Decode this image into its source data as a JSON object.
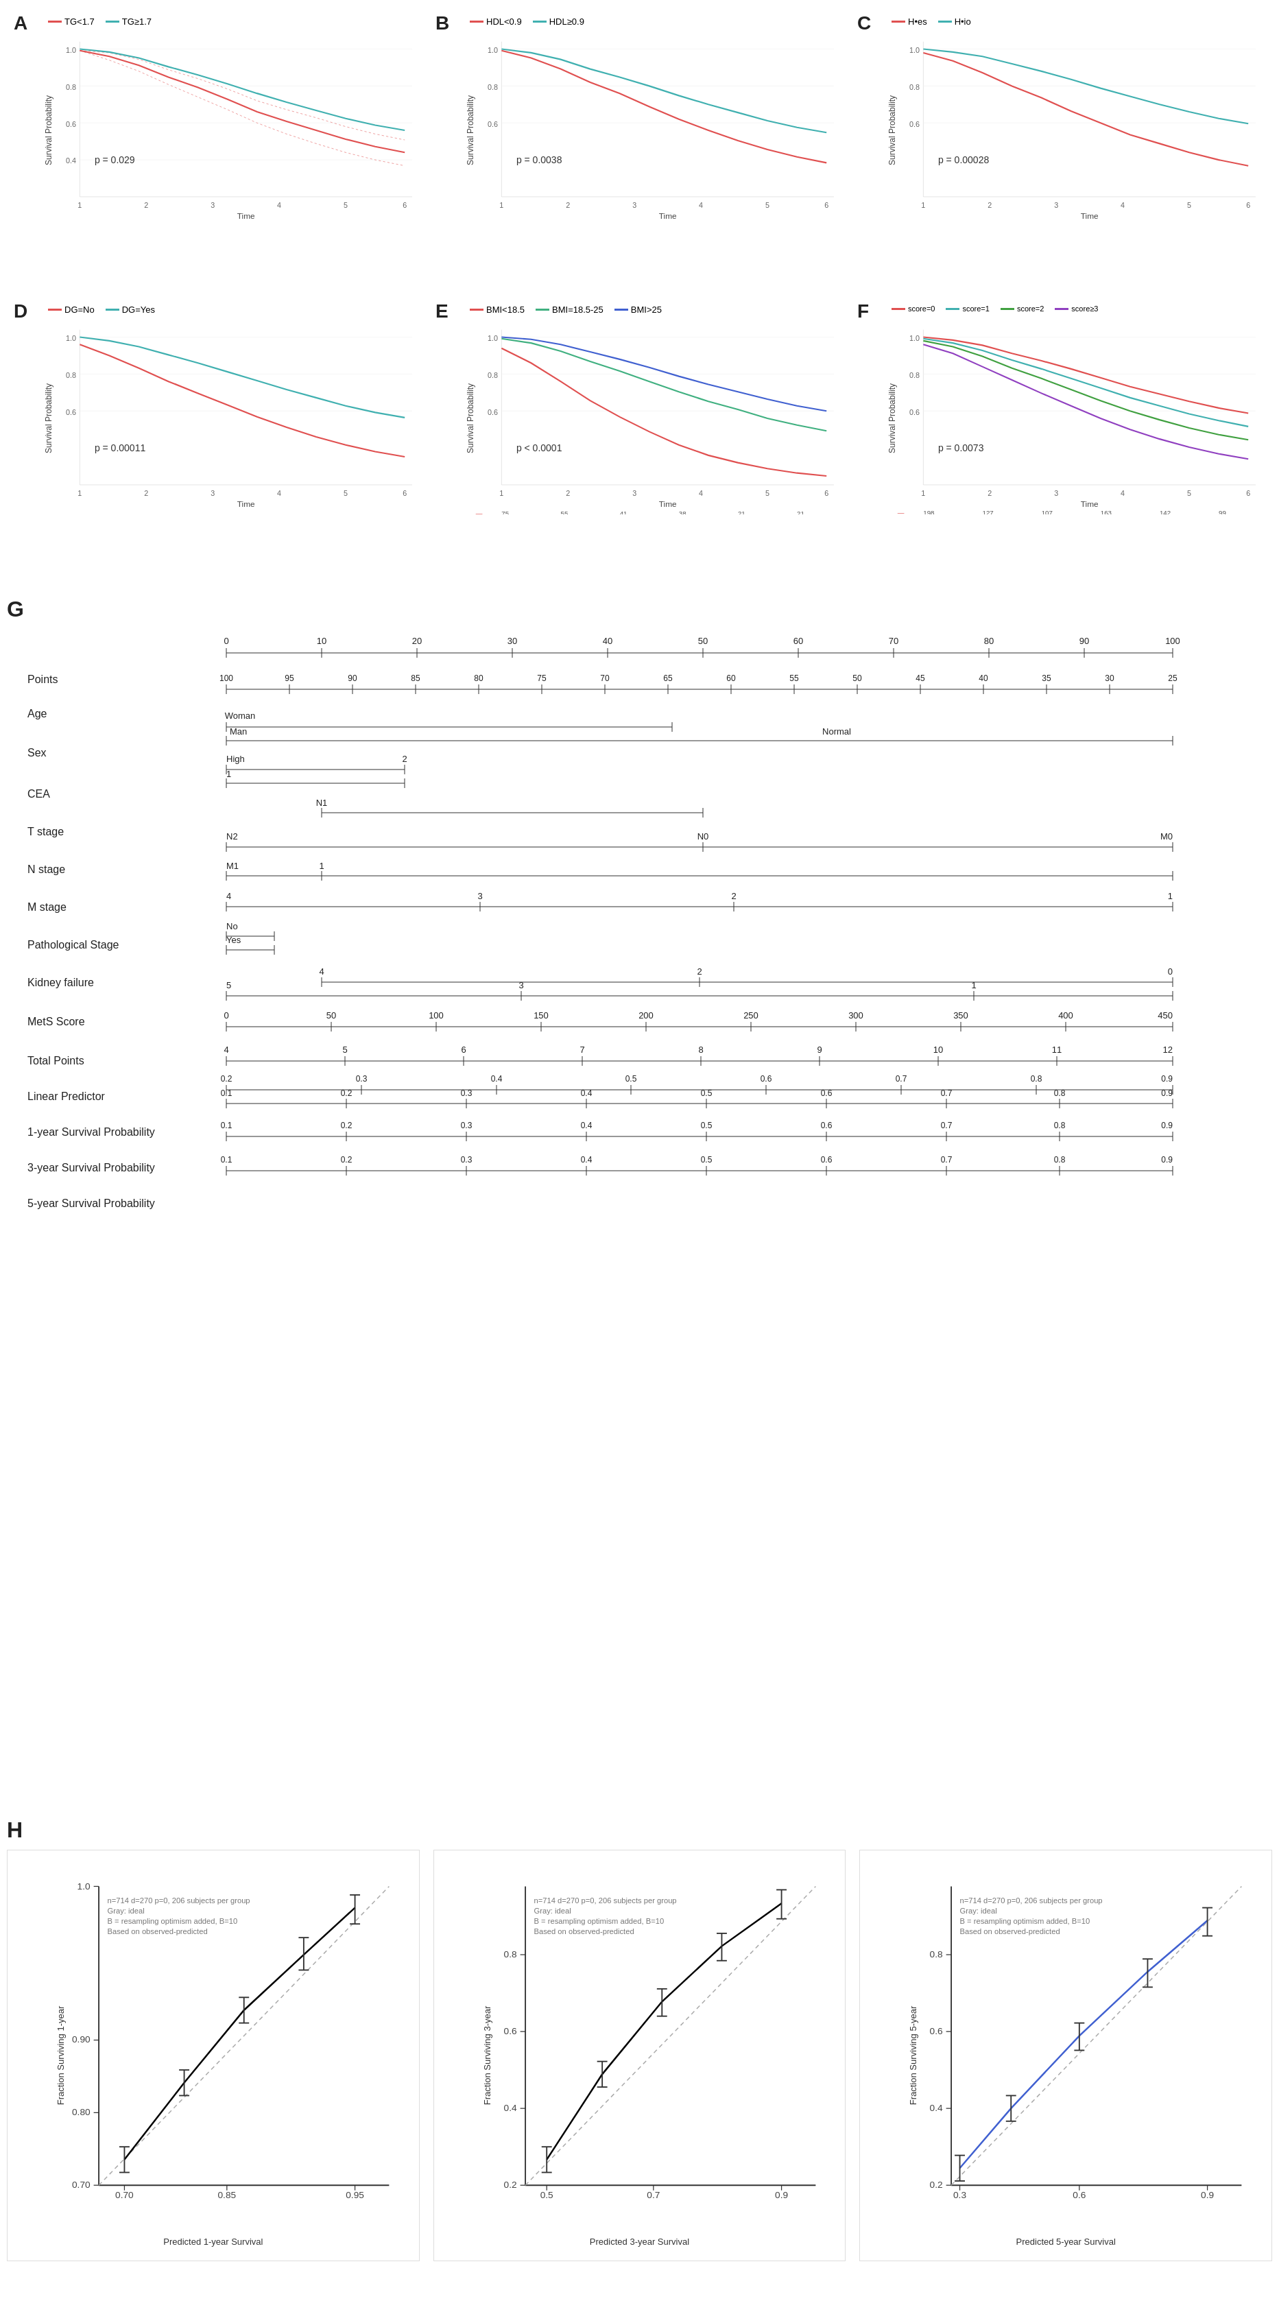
{
  "panels": {
    "A": {
      "label": "A",
      "legend": [
        {
          "text": "TG<1.7",
          "color": "#e05050"
        },
        {
          "text": "TG≥1.7",
          "color": "#40b0b0"
        }
      ],
      "pvalue": "p = 0.029",
      "yaxis": "Survival Probability",
      "xaxis": "Time"
    },
    "B": {
      "label": "B",
      "legend": [
        {
          "text": "HDL<0.9",
          "color": "#e05050"
        },
        {
          "text": "HDL≥0.9",
          "color": "#40b0b0"
        }
      ],
      "pvalue": "p = 0.0038",
      "yaxis": "Survival Probability",
      "xaxis": "Time"
    },
    "C": {
      "label": "C",
      "legend": [
        {
          "text": "H•es",
          "color": "#e05050"
        },
        {
          "text": "H•io",
          "color": "#40b0b0"
        }
      ],
      "pvalue": "p = 0.00028",
      "yaxis": "Survival Probability",
      "xaxis": "Time"
    },
    "D": {
      "label": "D",
      "legend": [
        {
          "text": "DG=No",
          "color": "#e05050"
        },
        {
          "text": "DG=Yes",
          "color": "#40b0b0"
        }
      ],
      "pvalue": "p = 0.00011",
      "yaxis": "Survival Probability",
      "xaxis": "Time"
    },
    "E": {
      "label": "E",
      "legend": [
        {
          "text": "BMI<18.5",
          "color": "#e05050"
        },
        {
          "text": "BMI=18.5-25",
          "color": "#40b080"
        },
        {
          "text": "BMI>25",
          "color": "#4060d0"
        }
      ],
      "pvalue": "p < 0.0001",
      "yaxis": "Survival Probability",
      "xaxis": "Time"
    },
    "F": {
      "label": "F",
      "legend": [
        {
          "text": "score=0",
          "color": "#e05050"
        },
        {
          "text": "score=1",
          "color": "#40b0b0"
        },
        {
          "text": "score=2",
          "color": "#40a040"
        },
        {
          "text": "score≥3",
          "color": "#9040c0"
        }
      ],
      "pvalue": "p = 0.0073",
      "yaxis": "Survival Probability",
      "xaxis": "Time"
    }
  },
  "nomogram": {
    "section_label": "G",
    "variables": [
      "Points",
      "Age",
      "Sex",
      "CEA",
      "T stage",
      "N stage",
      "M stage",
      "Pathological Stage",
      "Kidney failure",
      "MetS Score",
      "Total Points",
      "Linear Predictor",
      "1-year Survival Probability",
      "3-year Survival Probability",
      "5-year Survival Probability"
    ],
    "points_axis": {
      "min": 0,
      "max": 100,
      "ticks": [
        0,
        10,
        20,
        30,
        40,
        50,
        60,
        70,
        80,
        90,
        100
      ]
    },
    "age_axis": {
      "label": "100 95 90 85 80 75 70 65 60 55 50 45 40 35 30 25"
    },
    "sex_values": [
      "Woman",
      "Man",
      "Normal"
    ],
    "cea_values": [
      "High",
      "2",
      "1"
    ],
    "tstage_values": [
      "N1",
      "N2",
      "N0",
      "M0",
      "M1"
    ],
    "nstage_values": [
      "N1",
      "N2",
      "N0"
    ],
    "mstage_values": [
      "M0",
      "M1"
    ],
    "path_stage_values": [
      "3",
      "1",
      "4",
      "2"
    ],
    "kidney_values": [
      "No",
      "Yes"
    ],
    "mets_values": [
      "4",
      "2",
      "0",
      "5",
      "3",
      "1"
    ],
    "total_points": {
      "min": 0,
      "max": 450,
      "ticks": [
        0,
        50,
        100,
        150,
        200,
        250,
        300,
        350,
        400,
        450
      ]
    },
    "linear_pred": {
      "min": 4,
      "max": 12,
      "ticks": [
        4,
        5,
        6,
        7,
        8,
        9,
        10,
        11,
        12
      ]
    },
    "surv1yr": {
      "label": "0.2 0.3 0.4 0.5 0.6 0.7 0.8 0.9 / 0.1 0.2 0.3 0.4 0.5 0.6 0.7 0.8 0.9"
    },
    "surv3yr": {
      "label": "0.1 0.2 0.3 0.4 0.5 0.6 0.7 0.8 0.9"
    },
    "surv5yr": {
      "label": "0.1 0.2 0.3 0.4 0.5 0.6 0.7 0.8 0.9"
    }
  },
  "calibration": {
    "section_label": "H",
    "panels": [
      {
        "xlabel": "Predicted 1-year Survival",
        "ylabel": "Fraction Surviving 1-year",
        "xrange": [
          0.7,
          1.0
        ],
        "note": "n=714 d=270 p=0, 206 subjects per group\nGray: ideal\nB = resampling optimism added, B=10\nBased on observed-predicted"
      },
      {
        "xlabel": "Predicted 3-year Survival",
        "ylabel": "Fraction Surviving 3-year",
        "xrange": [
          0.5,
          1.0
        ],
        "note": "n=714 d=270 p=0, 206 subjects per group\nGray: ideal\nB = resampling optimism added, B=10\nBased on observed-predicted"
      },
      {
        "xlabel": "Predicted 5-year Survival",
        "ylabel": "Fraction Surviving 5-year",
        "xrange": [
          0.3,
          1.0
        ],
        "note": "n=714 d=270 p=0, 206 subjects per group\nGray: ideal\nB = resampling optimism added, B=10\nBased on observed-predicted"
      }
    ]
  }
}
